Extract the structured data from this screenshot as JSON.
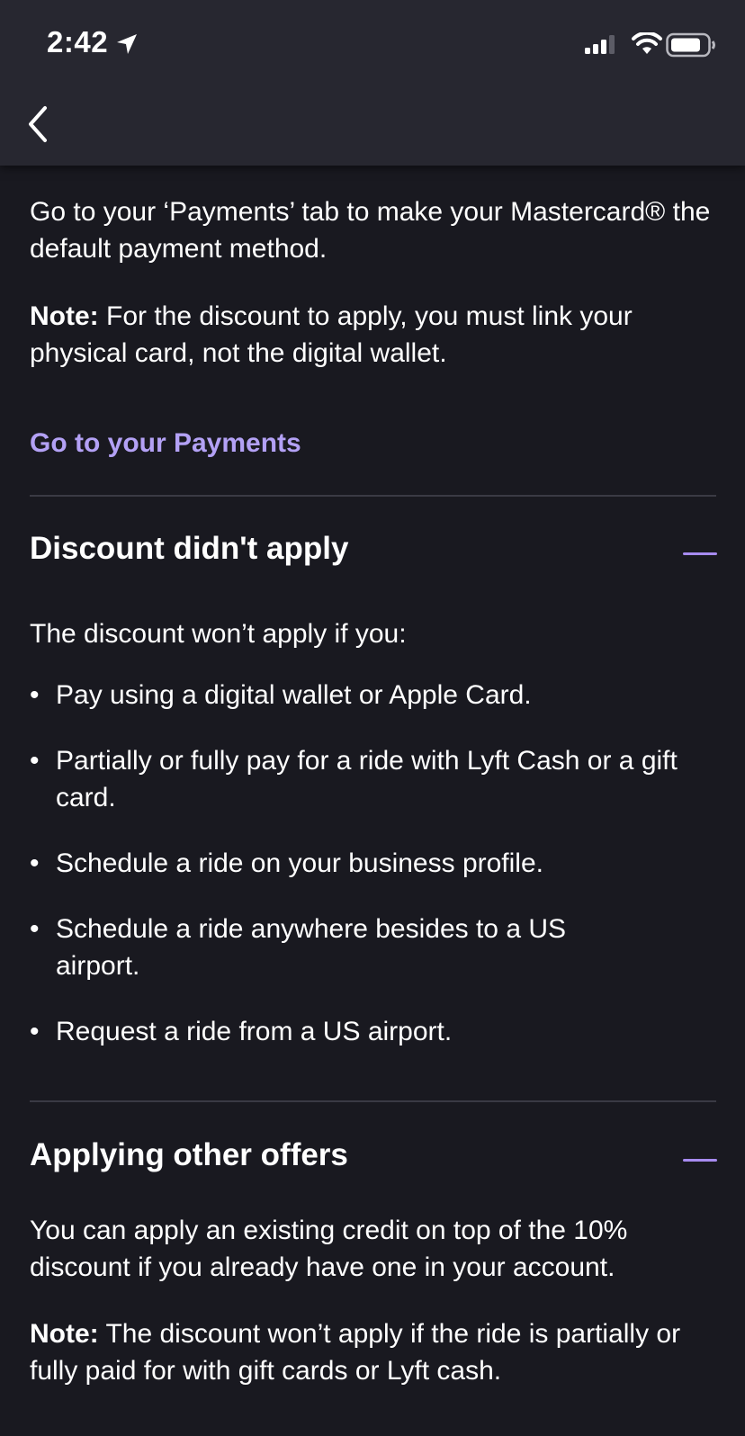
{
  "status_bar": {
    "time": "2:42"
  },
  "content": {
    "intro": "Go to your ‘Payments’ tab to make your Mastercard® the default payment method.",
    "note1_label": "Note:",
    "note1_text": " For the discount to apply, you must link your physical card, not the digital wallet.",
    "payments_link": "Go to your Payments"
  },
  "sections": [
    {
      "title": "Discount didn't apply",
      "intro": "The discount won’t apply if you:",
      "bullets": [
        "Pay using a digital wallet or Apple Card.",
        "Partially or fully pay for a ride with Lyft Cash or a gift card.",
        "Schedule a ride on your business profile.",
        "Schedule a ride anywhere besides to a US airport.",
        "Request a ride from a US airport."
      ]
    },
    {
      "title": "Applying other offers",
      "body": "You can apply an existing credit on top of the 10% discount if you already have one in your account.",
      "note_label": "Note:",
      "note_text": " The discount won’t apply if the ride is partially or fully paid for with gift cards or Lyft cash."
    }
  ],
  "bullet_char": "•",
  "icons": {
    "back": "chevron-left-icon",
    "collapse": "minus-icon",
    "location": "location-arrow-icon",
    "signal": "cellular-signal-icon",
    "wifi": "wifi-icon",
    "battery": "battery-icon"
  },
  "colors": {
    "background": "#191920",
    "header": "#272730",
    "link": "#b3a1f5",
    "accent": "#a78bf0",
    "divider": "#3a3a44"
  }
}
